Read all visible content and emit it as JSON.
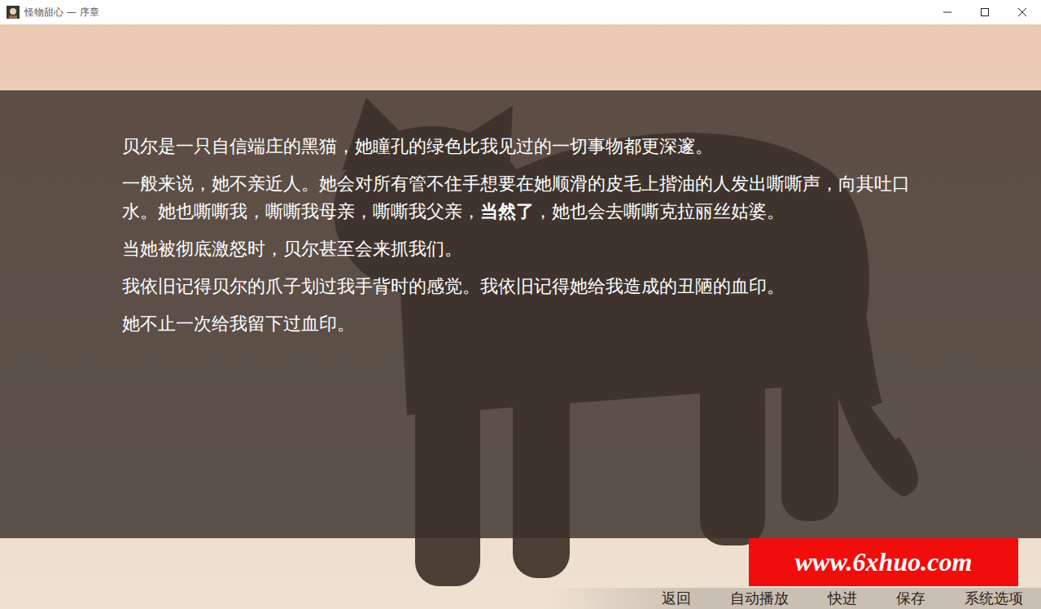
{
  "window": {
    "title": "怪物甜心 — 序章"
  },
  "dialogue": {
    "paragraphs": [
      [
        {
          "text": "贝尔是一只自信端庄的黑猫，她瞳孔的绿色比我见过的一切事物都更深邃。",
          "bold": false
        }
      ],
      [
        {
          "text": "一般来说，她不亲近人。她会对所有管不住手想要在她顺滑的皮毛上揩油的人发出嘶嘶声，向其吐口水。她也嘶嘶我，嘶嘶我母亲，嘶嘶我父亲，",
          "bold": false
        },
        {
          "text": "当然了",
          "bold": true
        },
        {
          "text": "，她也会去嘶嘶克拉丽丝姑婆。",
          "bold": false
        }
      ],
      [
        {
          "text": "当她被彻底激怒时，贝尔甚至会来抓我们。",
          "bold": false
        }
      ],
      [
        {
          "text": "我依旧记得贝尔的爪子划过我手背时的感觉。我依旧记得她给我造成的丑陋的血印。",
          "bold": false
        }
      ],
      [
        {
          "text": "她不止一次给我留下过血印。",
          "bold": false
        }
      ]
    ]
  },
  "watermark": "www.6xhuo.com",
  "menu": [
    "返回",
    "自动播放",
    "快进",
    "保存",
    "系统选项"
  ]
}
